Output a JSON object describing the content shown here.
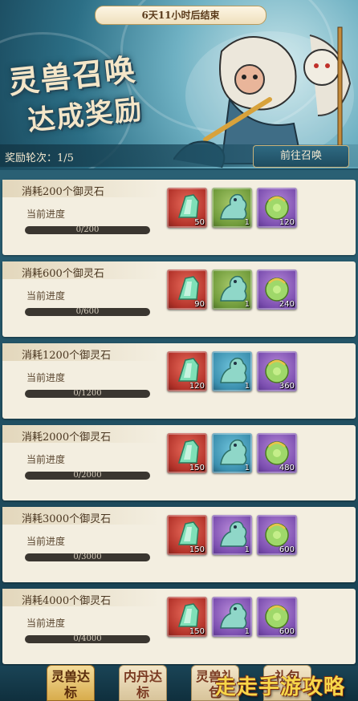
{
  "banner": {
    "timer": "6天11小时后结束",
    "title_line1": "灵兽召唤",
    "title_line2": "达成奖励",
    "round_label": "奖励轮次：1/5",
    "go_button": "前往召唤"
  },
  "progress_label": "当前进度",
  "cards": [
    {
      "title": "消耗200个御灵石",
      "progress_text": "0/200",
      "progress": 0,
      "rewards": [
        {
          "color": "red",
          "qty": "50"
        },
        {
          "color": "green",
          "qty": "1"
        },
        {
          "color": "purple",
          "qty": "120"
        }
      ]
    },
    {
      "title": "消耗600个御灵石",
      "progress_text": "0/600",
      "progress": 0,
      "rewards": [
        {
          "color": "red",
          "qty": "90"
        },
        {
          "color": "green",
          "qty": "1"
        },
        {
          "color": "purple",
          "qty": "240"
        }
      ]
    },
    {
      "title": "消耗1200个御灵石",
      "progress_text": "0/1200",
      "progress": 0,
      "rewards": [
        {
          "color": "red",
          "qty": "120"
        },
        {
          "color": "blue",
          "qty": "1"
        },
        {
          "color": "purple",
          "qty": "360"
        }
      ]
    },
    {
      "title": "消耗2000个御灵石",
      "progress_text": "0/2000",
      "progress": 0,
      "rewards": [
        {
          "color": "red",
          "qty": "150"
        },
        {
          "color": "blue",
          "qty": "1"
        },
        {
          "color": "purple",
          "qty": "480"
        }
      ]
    },
    {
      "title": "消耗3000个御灵石",
      "progress_text": "0/3000",
      "progress": 0,
      "rewards": [
        {
          "color": "red",
          "qty": "150"
        },
        {
          "color": "purple",
          "qty": "1"
        },
        {
          "color": "purple",
          "qty": "600"
        }
      ]
    },
    {
      "title": "消耗4000个御灵石",
      "progress_text": "0/4000",
      "progress": 0,
      "rewards": [
        {
          "color": "red",
          "qty": "150"
        },
        {
          "color": "purple",
          "qty": "1"
        },
        {
          "color": "purple",
          "qty": "600"
        }
      ]
    }
  ],
  "reward_icons": [
    "spirit-stone-icon",
    "beast-figure-icon",
    "spirit-pouch-icon"
  ],
  "bottom_nav": {
    "tabs": [
      {
        "label": "灵兽达标",
        "active": true
      },
      {
        "label": "内丹达标",
        "active": false
      },
      {
        "label": "灵兽礼包",
        "active": false
      },
      {
        "label": "礼包",
        "active": false
      }
    ],
    "watermark": "走走手游攻略"
  }
}
